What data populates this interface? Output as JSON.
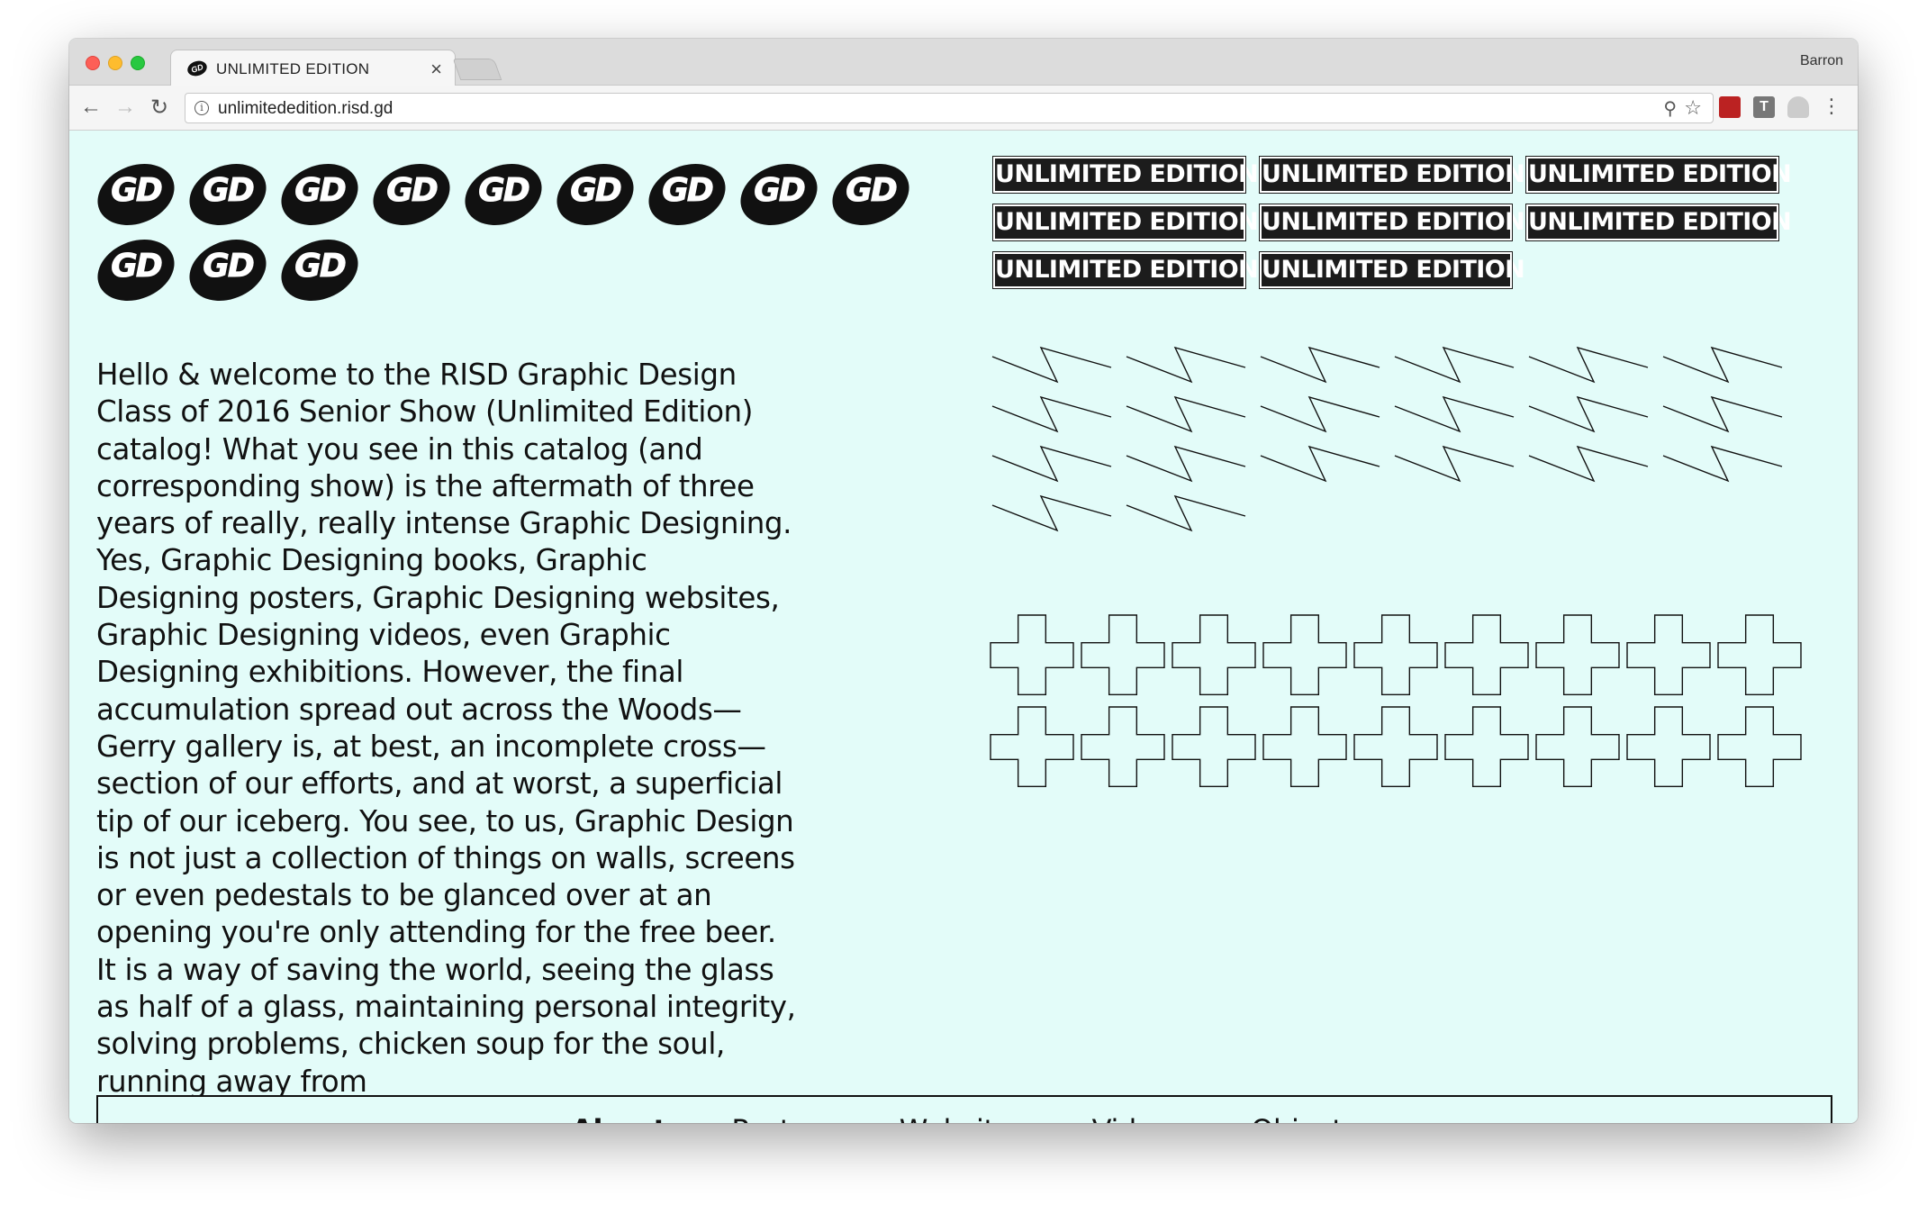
{
  "browser": {
    "tab_title": "UNLIMITED EDITION",
    "tab_close": "×",
    "profile_name": "Barron",
    "url": "unlimitededition.risd.gd",
    "ext_text": "T"
  },
  "logos": {
    "text": "GD",
    "count": 12
  },
  "intro_text": "Hello & welcome to the RISD Graphic Design Class of 2016 Senior Show (Unlimited Edition) catalog! What you see in this catalog (and corresponding show) is the aftermath of three years of really, really intense Graphic Designing. Yes, Graphic Designing books, Graphic Designing posters, Graphic Designing websites, Graphic Designing videos, even Graphic Designing exhibitions. However, the final accumulation spread out across the Woods—Gerry gallery is, at best, an incomplete cross—section of our efforts, and at worst, a superficial tip of our iceberg. You see, to us, Graphic Design is not just a collection of things on walls, screens or even pedestals to be glanced over at an opening you're only attending for the free beer. It is a way of saving the world, seeing the glass as half of a glass, maintaining personal integrity, solving problems, chicken soup for the soul, running away from",
  "badges": [
    "UNLIMITED EDITION",
    "UNLIMITED EDITION",
    "UNLIMITED EDITION",
    "UNLIMITED EDITION",
    "UNLIMITED EDITION",
    "UNLIMITED EDITION",
    "UNLIMITED EDITION",
    "UNLIMITED EDITION"
  ],
  "zigzag_count": 20,
  "cross_count": 18,
  "nav": {
    "about": "About",
    "posters": "Posters",
    "websites": "Websites",
    "videos": "Videos",
    "objects": "Objects",
    "active": "About"
  },
  "colors": {
    "page_bg": "#e3fcf9",
    "ink": "#111111",
    "badge_bg": "#1c1c1c"
  }
}
